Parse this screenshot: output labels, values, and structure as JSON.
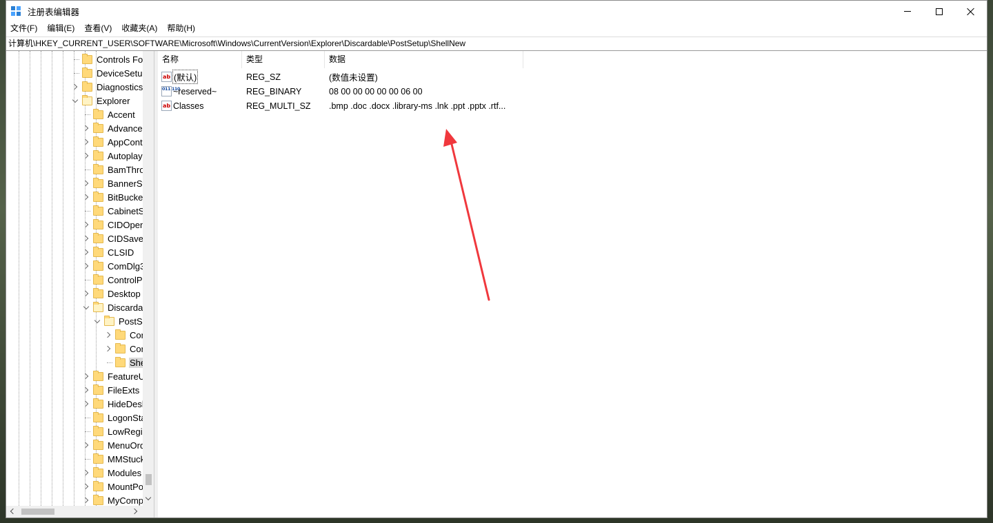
{
  "window": {
    "title": "注册表编辑器",
    "controls": {
      "minimize": "minimize",
      "maximize": "maximize",
      "close": "close"
    }
  },
  "menu": [
    "文件(F)",
    "编辑(E)",
    "查看(V)",
    "收藏夹(A)",
    "帮助(H)"
  ],
  "address": "计算机\\HKEY_CURRENT_USER\\SOFTWARE\\Microsoft\\Windows\\CurrentVersion\\Explorer\\Discardable\\PostSetup\\ShellNew",
  "tree": [
    {
      "label": "Controls Fol",
      "expander": "none",
      "level": 0
    },
    {
      "label": "DeviceSetup",
      "expander": "none",
      "level": 0
    },
    {
      "label": "Diagnostics",
      "expander": "right",
      "level": 0
    },
    {
      "label": "Explorer",
      "expander": "down",
      "level": 0
    },
    {
      "label": "Accent",
      "expander": "none",
      "level": 1
    },
    {
      "label": "Advancec",
      "expander": "right",
      "level": 1
    },
    {
      "label": "AppContr",
      "expander": "right",
      "level": 1
    },
    {
      "label": "Autoplayl",
      "expander": "right",
      "level": 1
    },
    {
      "label": "BamThro",
      "expander": "none",
      "level": 1
    },
    {
      "label": "BannerSt",
      "expander": "right",
      "level": 1
    },
    {
      "label": "BitBucket",
      "expander": "right",
      "level": 1
    },
    {
      "label": "CabinetSt",
      "expander": "none",
      "level": 1
    },
    {
      "label": "CIDOpen",
      "expander": "right",
      "level": 1
    },
    {
      "label": "CIDSave",
      "expander": "right",
      "level": 1
    },
    {
      "label": "CLSID",
      "expander": "right",
      "level": 1
    },
    {
      "label": "ComDlg3",
      "expander": "right",
      "level": 1
    },
    {
      "label": "ControlPa",
      "expander": "none",
      "level": 1
    },
    {
      "label": "Desktop",
      "expander": "right",
      "level": 1
    },
    {
      "label": "Discardab",
      "expander": "down",
      "level": 1
    },
    {
      "label": "PostSe",
      "expander": "down",
      "level": 2
    },
    {
      "label": "Con",
      "expander": "right",
      "level": 3
    },
    {
      "label": "Con",
      "expander": "right",
      "level": 3
    },
    {
      "label": "She",
      "expander": "none",
      "level": 3,
      "selected": true
    },
    {
      "label": "FeatureU:",
      "expander": "right",
      "level": 1
    },
    {
      "label": "FileExts",
      "expander": "right",
      "level": 1
    },
    {
      "label": "HideDesk",
      "expander": "right",
      "level": 1
    },
    {
      "label": "LogonSta",
      "expander": "none",
      "level": 1
    },
    {
      "label": "LowRegis",
      "expander": "none",
      "level": 1
    },
    {
      "label": "MenuOrd",
      "expander": "right",
      "level": 1
    },
    {
      "label": "MMStuck",
      "expander": "none",
      "level": 1
    },
    {
      "label": "Modules",
      "expander": "right",
      "level": 1
    },
    {
      "label": "MountPo",
      "expander": "right",
      "level": 1
    },
    {
      "label": "MyComp",
      "expander": "right",
      "level": 1
    }
  ],
  "columns": {
    "name": "名称",
    "type": "类型",
    "data": "数据"
  },
  "values": [
    {
      "icon": "string-value-icon",
      "icon_text": "ab",
      "name": "(默认)",
      "type": "REG_SZ",
      "data": "(数值未设置)"
    },
    {
      "icon": "binary-value-icon",
      "icon_text": "011 110",
      "name": "~reserved~",
      "type": "REG_BINARY",
      "data": "08 00 00 00 00 00 06 00"
    },
    {
      "icon": "string-value-icon",
      "icon_text": "ab",
      "name": "Classes",
      "type": "REG_MULTI_SZ",
      "data": ".bmp .doc .docx .library-ms .lnk .ppt .pptx .rtf..."
    }
  ],
  "colors": {
    "annotation_arrow": "#f0383d",
    "selection": "#d9d9d9",
    "folder": "#ffd97a"
  }
}
